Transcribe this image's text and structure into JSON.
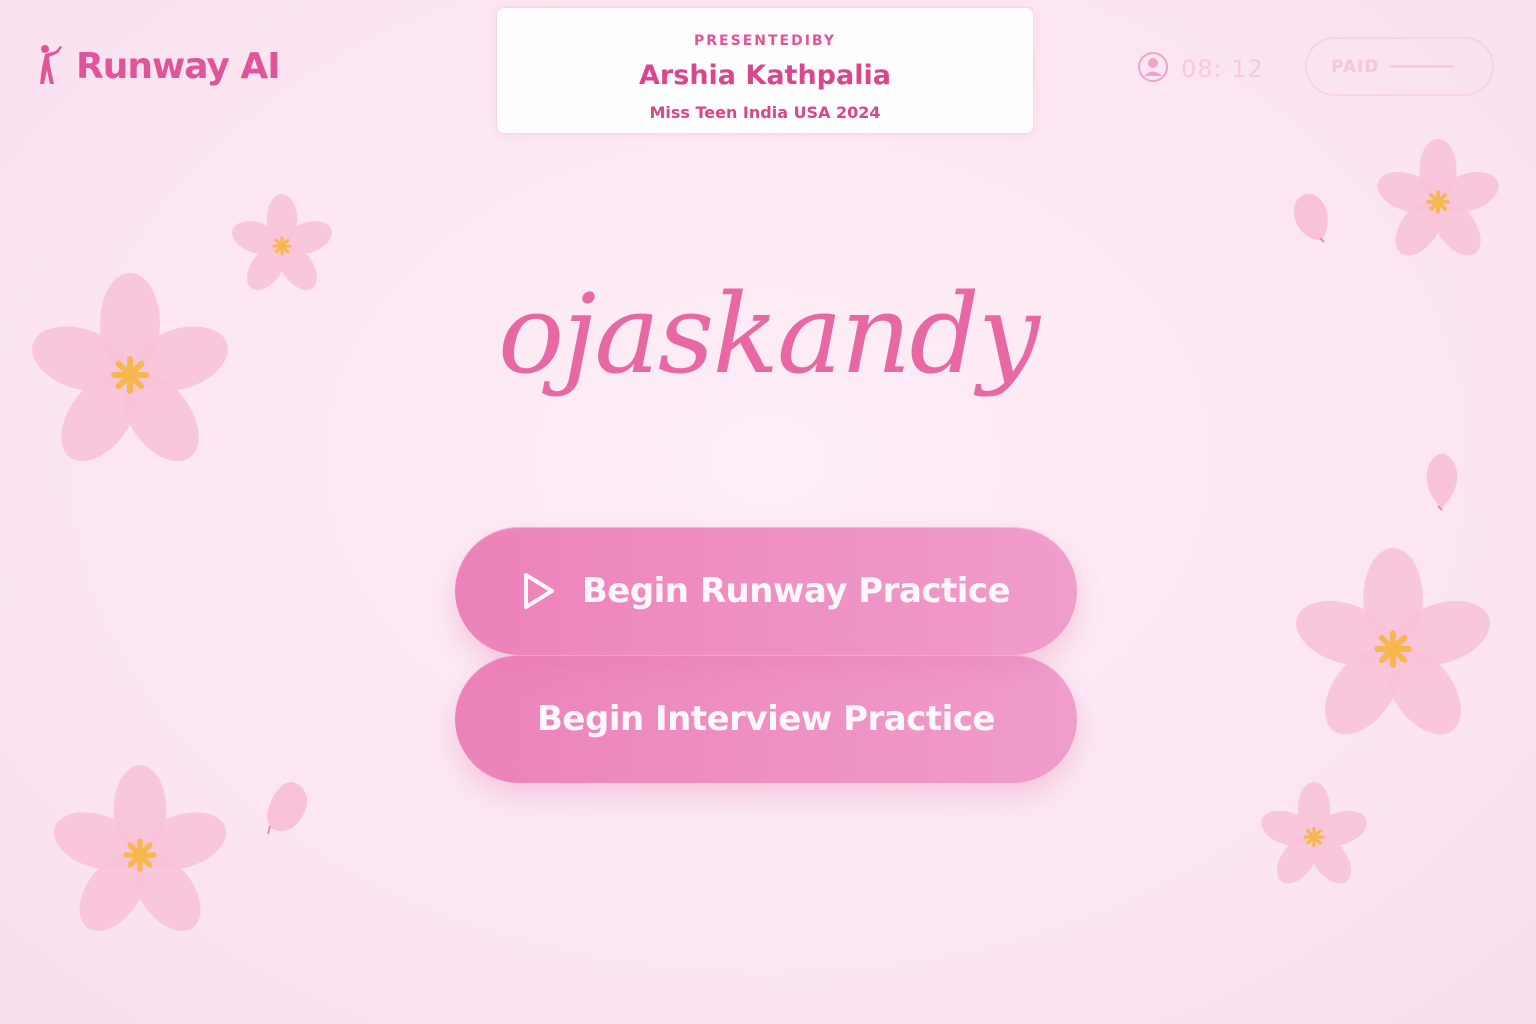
{
  "header": {
    "brand_name": "Runway AI",
    "brand_icon": "runway-walker-icon",
    "presenter_card": {
      "presented_by": "PRESENTEDIBY",
      "name": "Arshia Kathpalia",
      "title": "Miss Teen India USA 2024"
    },
    "timer": "08: 12",
    "user_icon": "user-circle-icon",
    "paid_label": "PAID"
  },
  "main": {
    "username": "ojaskandy",
    "buttons": {
      "runway_practice": "Begin Runway Practice",
      "interview_practice": "Begin Interview Practice"
    },
    "play_icon": "play-icon"
  },
  "colors": {
    "accent": "#e0559a",
    "button_start": "#ec82b9",
    "button_end": "#f09dcc",
    "flower_petal": "#f8c3d8",
    "flower_center": "#f6b74e",
    "background": "#fce8f3"
  },
  "decorations": {
    "icon": "cherry-blossom-icon"
  }
}
